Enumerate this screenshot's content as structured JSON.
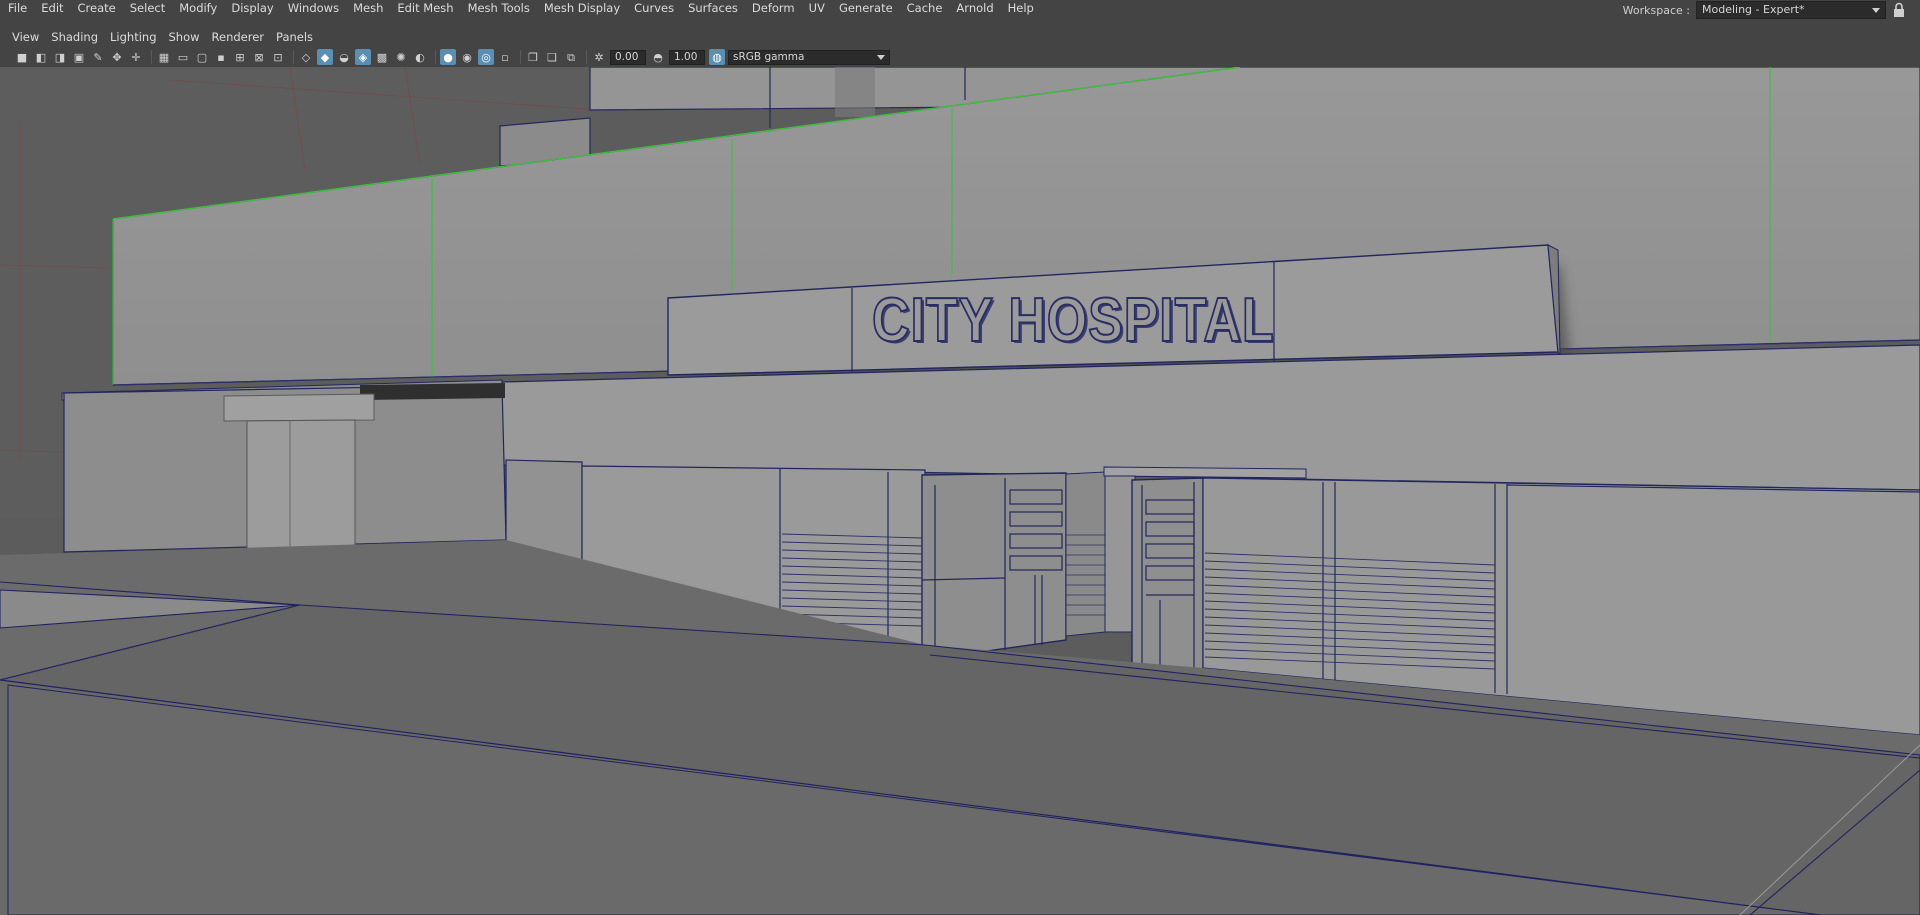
{
  "menubar": {
    "items": [
      "File",
      "Edit",
      "Create",
      "Select",
      "Modify",
      "Display",
      "Windows",
      "Mesh",
      "Edit Mesh",
      "Mesh Tools",
      "Mesh Display",
      "Curves",
      "Surfaces",
      "Deform",
      "UV",
      "Generate",
      "Cache",
      "Arnold",
      "Help"
    ]
  },
  "workspace": {
    "label": "Workspace :",
    "value": "Modeling - Expert*"
  },
  "panel_menu": {
    "items": [
      "View",
      "Shading",
      "Lighting",
      "Show",
      "Renderer",
      "Panels"
    ]
  },
  "toolbar": {
    "exposure": "0.00",
    "gamma": "1.00",
    "color_space": "sRGB gamma"
  },
  "viewport": {
    "sign_text": "CITY HOSPITAL"
  },
  "colors": {
    "ui_background": "#444444",
    "viewport_ground": "#5e5e5e",
    "wireframe": "#1e2266",
    "selection_green": "#3fbf3f",
    "active_button": "#5a8fb3"
  }
}
